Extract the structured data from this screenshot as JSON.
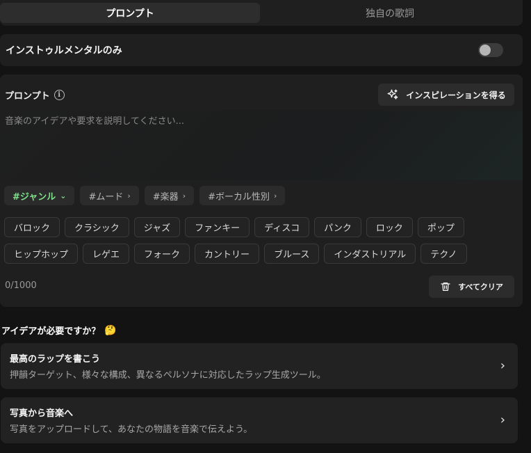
{
  "tabs": [
    {
      "label": "プロンプト",
      "active": true
    },
    {
      "label": "独自の歌詞",
      "active": false
    }
  ],
  "instrumental": {
    "label": "インストゥルメンタルのみ",
    "enabled": false
  },
  "prompt": {
    "title": "プロンプト",
    "info_icon": "info-icon",
    "inspire_label": "インスピレーションを得る",
    "inspire_icon": "sparkles-icon",
    "placeholder": "音楽のアイデアや要求を説明してください...",
    "categories": [
      {
        "label": "#ジャンル",
        "active": true,
        "chevron": "⌄"
      },
      {
        "label": "#ムード",
        "active": false,
        "chevron": "›"
      },
      {
        "label": "#楽器",
        "active": false,
        "chevron": "›"
      },
      {
        "label": "#ボーカル性別",
        "active": false,
        "chevron": "›"
      }
    ],
    "genres_row1": [
      "バロック",
      "クラシック",
      "ジャズ",
      "ファンキー",
      "ディスコ",
      "パンク",
      "ロック",
      "ポップ"
    ],
    "genres_row2": [
      "ヒップホップ",
      "レゲエ",
      "フォーク",
      "カントリー",
      "ブルース",
      "インダストリアル",
      "テクノ"
    ],
    "counter": "0/1000",
    "clear_label": "すべてクリア",
    "clear_icon": "trash-icon"
  },
  "ideas": {
    "heading": "アイデアが必要ですか？",
    "emoji": "🤔",
    "cards": [
      {
        "title": "最高のラップを書こう",
        "description": "押韻ターゲット、様々な構成、異なるペルソナに対応したラップ生成ツール。"
      },
      {
        "title": "写真から音楽へ",
        "description": "写真をアップロードして、あなたの物語を音楽で伝えよう。"
      }
    ]
  },
  "colors": {
    "background": "#131313",
    "panel": "#1f1f1f",
    "accent_green": "#7ee28b"
  }
}
